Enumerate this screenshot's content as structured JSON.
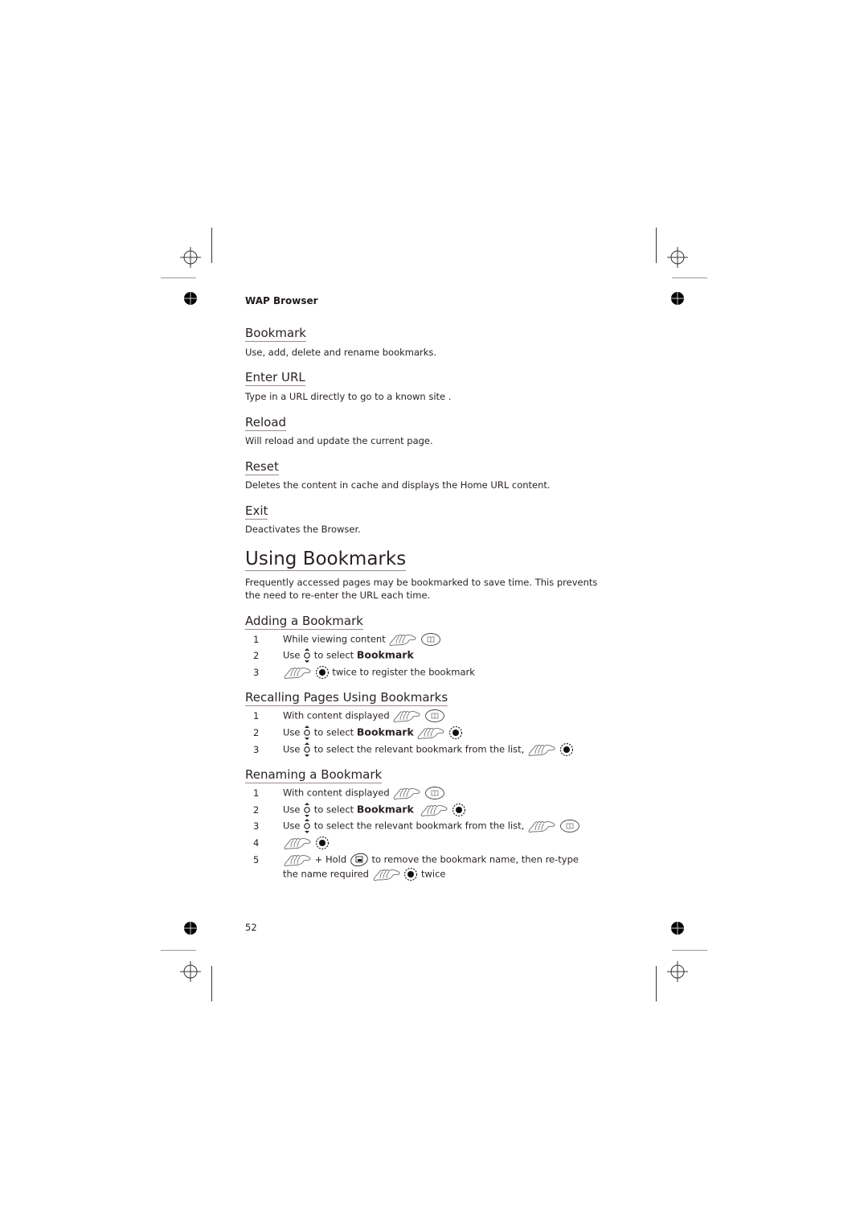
{
  "header": {
    "running_head": "WAP Browser"
  },
  "menu_items": [
    {
      "title": "Bookmark",
      "description": "Use, add, delete and rename bookmarks."
    },
    {
      "title": "Enter URL",
      "description": "Type in a URL directly to go to a known site ."
    },
    {
      "title": "Reload",
      "description": "Will reload and update the current page."
    },
    {
      "title": "Reset",
      "description": "Deletes the content in cache and displays the Home URL content."
    },
    {
      "title": "Exit",
      "description": "Deactivates the Browser."
    }
  ],
  "section": {
    "title": "Using Bookmarks",
    "intro_line1": "Frequently accessed pages may be bookmarked to save time. This prevents",
    "intro_line2": "the need to re-enter the URL each time."
  },
  "adding": {
    "title": "Adding a Bookmark",
    "steps": [
      {
        "num": "1",
        "text": "While viewing content",
        "icons": [
          "press-key-icon",
          "bookmark-key-icon"
        ]
      },
      {
        "num": "2",
        "pre": "Use",
        "icon": "navigation-key-icon",
        "text": "to select",
        "bold": "Bookmark"
      },
      {
        "num": "3",
        "icons": [
          "press-key-icon",
          "ok-key-icon"
        ],
        "text": "twice to register the bookmark"
      }
    ]
  },
  "recalling": {
    "title": "Recalling Pages Using Bookmarks",
    "steps": [
      {
        "num": "1",
        "text": "With content displayed"
      },
      {
        "num": "2",
        "pre": "Use",
        "text": "to select",
        "bold": "Bookmark"
      },
      {
        "num": "3",
        "pre": "Use",
        "text": "to select the relevant bookmark from the list,"
      }
    ]
  },
  "renaming": {
    "title": "Renaming a Bookmark",
    "steps": [
      {
        "num": "1",
        "text": "With content displayed"
      },
      {
        "num": "2",
        "pre": "Use",
        "text": "to select",
        "bold": "Bookmark"
      },
      {
        "num": "3",
        "pre": "Use",
        "text": "to select the relevant bookmark from the list,"
      },
      {
        "num": "4"
      },
      {
        "num": "5",
        "plus_hold": "+ Hold",
        "text": "to remove the bookmark name, then re-type",
        "cont_text": "the name required",
        "cont_suffix": "twice"
      }
    ]
  },
  "footer": {
    "page_number": "52"
  }
}
